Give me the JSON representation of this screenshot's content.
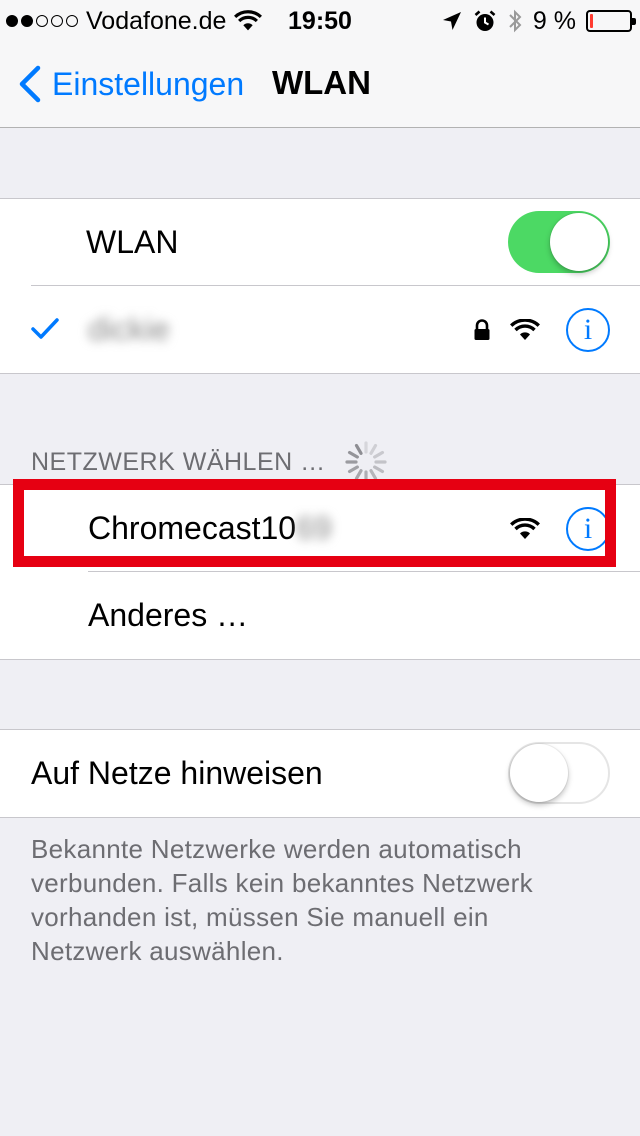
{
  "status_bar": {
    "signal_filled": 2,
    "signal_total": 5,
    "carrier": "Vodafone.de",
    "time": "19:50",
    "battery_text": "9 %",
    "battery_level": 0.09,
    "icons": [
      "wifi-icon",
      "location-icon",
      "alarm-icon",
      "bluetooth-icon",
      "battery-icon"
    ]
  },
  "nav": {
    "back_label": "Einstellungen",
    "title": "WLAN"
  },
  "wlan_group": {
    "toggle_label": "WLAN",
    "toggle_state": "on",
    "connected_network": "dickie"
  },
  "choose_section": {
    "header": "NETZWERK WÄHLEN …",
    "networks": [
      {
        "name_visible": "Chromecast10",
        "name_blurred": "69",
        "secured": false
      }
    ],
    "other_label": "Anderes …"
  },
  "ask_group": {
    "label": "Auf Netze hinweisen",
    "toggle_state": "off"
  },
  "footer": {
    "text": "Bekannte Netzwerke werden automatisch verbunden. Falls kein bekanntes Netzwerk vorhanden ist, müssen Sie manuell ein Netzwerk auswählen."
  },
  "colors": {
    "accent": "#007aff",
    "toggle_on": "#4cd964",
    "highlight": "#e60012",
    "battery_low": "#ff3b30"
  }
}
